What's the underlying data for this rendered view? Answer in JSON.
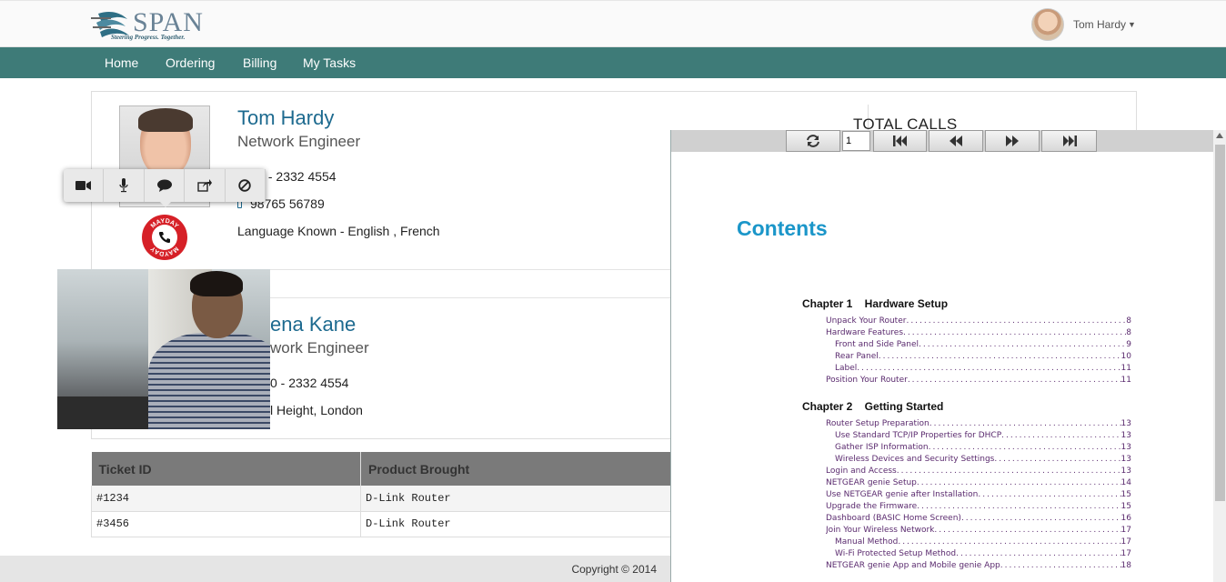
{
  "header": {
    "logo_word": "SPAN",
    "logo_tagline": "Steering Progress. Together.",
    "user_name": "Tom Hardy"
  },
  "nav": {
    "items": [
      "Home",
      "Ordering",
      "Billing",
      "My Tasks"
    ]
  },
  "stats": {
    "total_calls_label": "TOTAL CALLS"
  },
  "contacts": [
    {
      "name": "Tom Hardy",
      "role": "Network Engineer",
      "phone": "+0 - 2332 4554",
      "mobile": "98765 56789",
      "extra": "Language Known - English , French"
    },
    {
      "name": "ena Kane",
      "role": "work Engineer",
      "phone": "0 - 2332 4554",
      "extra": "l Height, London"
    }
  ],
  "badge": {
    "text": "MAYDAY"
  },
  "table": {
    "headers": [
      "Ticket ID",
      "Product Brought"
    ],
    "rows": [
      [
        "#1234",
        "D-Link Router"
      ],
      [
        "#3456",
        "D-Link Router"
      ]
    ]
  },
  "footer": {
    "copyright": "Copyright © 2014"
  },
  "viewer": {
    "page_value": "1",
    "contents_title": "Contents",
    "chapters": [
      {
        "title": "Chapter 1    Hardware Setup",
        "entries": [
          {
            "label": "Unpack Your Router",
            "page": "8",
            "indent": 0
          },
          {
            "label": "Hardware Features",
            "page": "8",
            "indent": 0
          },
          {
            "label": "Front and Side Panel",
            "page": "9",
            "indent": 1
          },
          {
            "label": "Rear Panel",
            "page": "10",
            "indent": 1
          },
          {
            "label": "Label",
            "page": "11",
            "indent": 1
          },
          {
            "label": "Position Your Router",
            "page": "11",
            "indent": 0
          }
        ]
      },
      {
        "title": "Chapter 2    Getting Started",
        "entries": [
          {
            "label": "Router Setup Preparation",
            "page": "13",
            "indent": 0
          },
          {
            "label": "Use Standard TCP/IP Properties for DHCP",
            "page": "13",
            "indent": 1
          },
          {
            "label": "Gather ISP Information",
            "page": "13",
            "indent": 1
          },
          {
            "label": "Wireless Devices and Security Settings",
            "page": "13",
            "indent": 1
          },
          {
            "label": "Login and Access",
            "page": "13",
            "indent": 0
          },
          {
            "label": "NETGEAR genie Setup",
            "page": "14",
            "indent": 0
          },
          {
            "label": "Use NETGEAR genie after Installation",
            "page": "15",
            "indent": 0
          },
          {
            "label": "Upgrade the Firmware",
            "page": "15",
            "indent": 0
          },
          {
            "label": "Dashboard (BASIC Home Screen)",
            "page": "16",
            "indent": 0
          },
          {
            "label": "Join Your Wireless Network",
            "page": "17",
            "indent": 0
          },
          {
            "label": "Manual Method",
            "page": "17",
            "indent": 1
          },
          {
            "label": "Wi-Fi Protected Setup Method",
            "page": "17",
            "indent": 1
          },
          {
            "label": "NETGEAR genie App and Mobile genie App",
            "page": "18",
            "indent": 0
          }
        ]
      }
    ]
  }
}
